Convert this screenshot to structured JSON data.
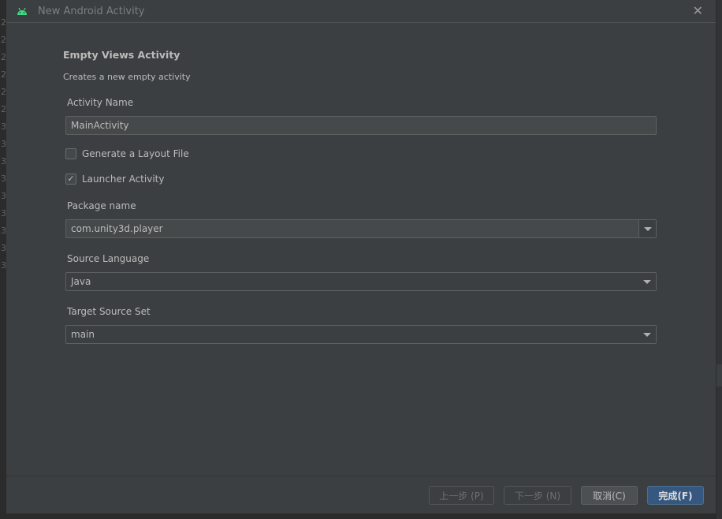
{
  "dialog": {
    "title": "New Android Activity",
    "icon": "android-icon",
    "close_icon": "close-icon"
  },
  "background": {
    "line_numbers": [
      "2",
      "2",
      "2",
      "2",
      "2",
      "2",
      "3",
      "3",
      "3",
      "3",
      "3",
      "3",
      "3",
      "3",
      "3"
    ]
  },
  "template": {
    "heading": "Empty Views Activity",
    "description": "Creates a new empty activity"
  },
  "form": {
    "activity_name": {
      "label": "Activity Name",
      "value": "MainActivity"
    },
    "generate_layout": {
      "label": "Generate a Layout File",
      "checked": false
    },
    "launcher_activity": {
      "label": "Launcher Activity",
      "checked": true,
      "mark": "✓"
    },
    "package_name": {
      "label": "Package name",
      "value": "com.unity3d.player"
    },
    "source_language": {
      "label": "Source Language",
      "value": "Java"
    },
    "target_source_set": {
      "label": "Target Source Set",
      "value": "main"
    }
  },
  "footer": {
    "previous": "上一步 (P)",
    "next": "下一步 (N)",
    "cancel": "取消(C)",
    "finish": "完成(F)"
  },
  "colors": {
    "accent": "#365880",
    "android": "#3ddc84",
    "background": "#3c3f41"
  }
}
